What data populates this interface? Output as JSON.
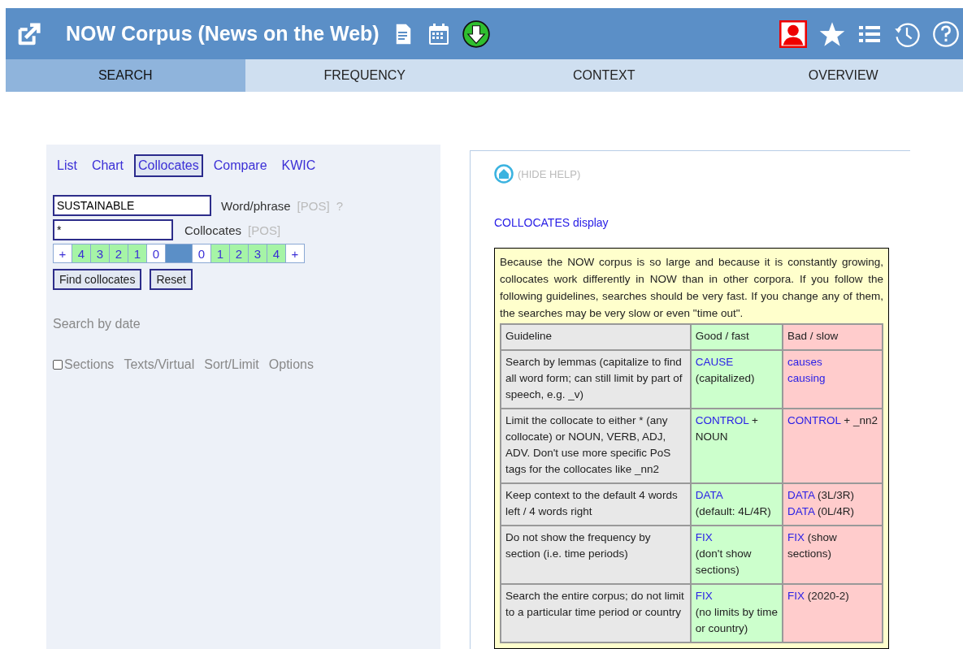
{
  "header": {
    "title": "NOW Corpus (News on the Web)"
  },
  "nav_tabs": [
    {
      "label": "SEARCH",
      "selected": true
    },
    {
      "label": "FREQUENCY",
      "selected": false
    },
    {
      "label": "CONTEXT",
      "selected": false
    },
    {
      "label": "OVERVIEW",
      "selected": false
    }
  ],
  "search_panel": {
    "modes": [
      {
        "label": "List",
        "selected": false
      },
      {
        "label": "Chart",
        "selected": false
      },
      {
        "label": "Collocates",
        "selected": true
      },
      {
        "label": "Compare",
        "selected": false
      },
      {
        "label": "KWIC",
        "selected": false
      }
    ],
    "word_field": {
      "value": "SUSTAINABLE",
      "label": "Word/phrase",
      "pos_link": "[POS]",
      "help_link": "?"
    },
    "collocate_field": {
      "value": "*",
      "label": "Collocates",
      "pos_link": "[POS]"
    },
    "span": [
      {
        "kind": "plus",
        "label": "+"
      },
      {
        "kind": "number",
        "label": "4",
        "selected": true
      },
      {
        "kind": "number",
        "label": "3",
        "selected": true
      },
      {
        "kind": "number",
        "label": "2",
        "selected": true
      },
      {
        "kind": "number",
        "label": "1",
        "selected": true
      },
      {
        "kind": "number",
        "label": "0",
        "selected": false
      },
      {
        "kind": "node"
      },
      {
        "kind": "number",
        "label": "0",
        "selected": false
      },
      {
        "kind": "number",
        "label": "1",
        "selected": true
      },
      {
        "kind": "number",
        "label": "2",
        "selected": true
      },
      {
        "kind": "number",
        "label": "3",
        "selected": true
      },
      {
        "kind": "number",
        "label": "4",
        "selected": true
      },
      {
        "kind": "plus",
        "label": "+"
      }
    ],
    "buttons": [
      "Find collocates",
      "Reset"
    ],
    "date_link": "Search by date",
    "options": [
      {
        "kind": "checkbox",
        "label": "Sections",
        "checked": false
      },
      {
        "kind": "link",
        "label": "Texts/Virtual"
      },
      {
        "kind": "link",
        "label": "Sort/Limit"
      },
      {
        "kind": "link",
        "label": "Options"
      }
    ]
  },
  "help": {
    "hide_link": "(HIDE HELP)",
    "heading": "COLLOCATES display",
    "intro": "Because the NOW corpus is so large and because it is constantly growing, collocates work differently in NOW than in other corpora. If you follow the following guidelines, searches should be very fast. If you change any of them, the searches may be very slow or even \"time out\".",
    "columns": [
      "Guideline",
      "Good / fast",
      "Bad / slow"
    ],
    "rows": [
      {
        "guideline": "Search by lemmas (capitalize to find all word form; can still limit by part of speech, e.g. _v)",
        "good": [
          [
            {
              "kind": "link",
              "text": "CAUSE"
            }
          ],
          [
            {
              "kind": "text",
              "text": "(capitalized)"
            }
          ]
        ],
        "bad": [
          [
            {
              "kind": "link",
              "text": "causes"
            }
          ],
          [
            {
              "kind": "link",
              "text": "causing"
            }
          ]
        ]
      },
      {
        "guideline": "Limit the collocate to either * (any collocate) or NOUN, VERB, ADJ, ADV. Don't use more specific PoS tags for the collocates like _nn2",
        "good": [
          [
            {
              "kind": "link",
              "text": "CONTROL"
            },
            {
              "kind": "text",
              "text": " +"
            }
          ],
          [
            {
              "kind": "text",
              "text": "NOUN"
            }
          ]
        ],
        "bad": [
          [
            {
              "kind": "link",
              "text": "CONTROL"
            },
            {
              "kind": "text",
              "text": " + _nn2"
            }
          ]
        ]
      },
      {
        "guideline": "Keep context to the default 4 words left / 4 words right",
        "good": [
          [
            {
              "kind": "link",
              "text": "DATA"
            }
          ],
          [
            {
              "kind": "text",
              "text": "(default: 4L/4R)"
            }
          ]
        ],
        "bad": [
          [
            {
              "kind": "link",
              "text": "DATA"
            },
            {
              "kind": "text",
              "text": " (3L/3R)"
            }
          ],
          [
            {
              "kind": "link",
              "text": "DATA"
            },
            {
              "kind": "text",
              "text": " (0L/4R)"
            }
          ]
        ]
      },
      {
        "guideline": "Do not show the frequency by section (i.e. time periods)",
        "good": [
          [
            {
              "kind": "link",
              "text": "FIX"
            }
          ],
          [
            {
              "kind": "text",
              "text": "(don't show"
            }
          ],
          [
            {
              "kind": "text",
              "text": "sections)"
            }
          ]
        ],
        "bad": [
          [
            {
              "kind": "link",
              "text": "FIX"
            },
            {
              "kind": "text",
              "text": " (show"
            }
          ],
          [
            {
              "kind": "text",
              "text": "sections)"
            }
          ]
        ]
      },
      {
        "guideline": "Search the entire corpus; do not limit to a particular time period or country",
        "good": [
          [
            {
              "kind": "link",
              "text": "FIX"
            }
          ],
          [
            {
              "kind": "text",
              "text": "(no limits by time"
            }
          ],
          [
            {
              "kind": "text",
              "text": "or country)"
            }
          ]
        ],
        "bad": [
          [
            {
              "kind": "link",
              "text": "FIX"
            },
            {
              "kind": "text",
              "text": " (2020-2)"
            }
          ]
        ]
      }
    ]
  }
}
